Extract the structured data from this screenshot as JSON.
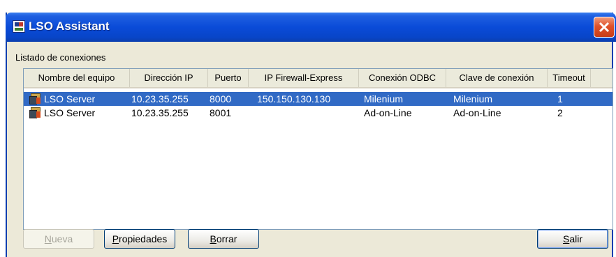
{
  "window": {
    "title": "LSO Assistant"
  },
  "group": {
    "label": "Listado de conexiones"
  },
  "columns": [
    "Nombre del equipo",
    "Dirección IP",
    "Puerto",
    "IP Firewall-Express",
    "Conexión ODBC",
    "Clave de conexión",
    "Timeout"
  ],
  "rows": [
    {
      "name": "LSO Server",
      "ip": "10.23.35.255",
      "port": "8000",
      "firewall": "150.150.130.130",
      "odbc": "Milenium",
      "key": "Milenium",
      "timeout": "1",
      "selected": true
    },
    {
      "name": "LSO Server",
      "ip": "10.23.35.255",
      "port": "8001",
      "firewall": "",
      "odbc": "Ad-on-Line",
      "key": "Ad-on-Line",
      "timeout": "2",
      "selected": false
    }
  ],
  "buttons": {
    "nueva": {
      "mnemonic": "N",
      "rest": "ueva",
      "enabled": false
    },
    "propiedades": {
      "mnemonic": "P",
      "rest": "ropiedades"
    },
    "borrar": {
      "mnemonic": "B",
      "rest": "orrar"
    },
    "salir": {
      "mnemonic": "S",
      "rest": "alir"
    }
  },
  "colors": {
    "titlebar": "#0a4bd8",
    "selection": "#316ac5",
    "face": "#ece9d8"
  }
}
